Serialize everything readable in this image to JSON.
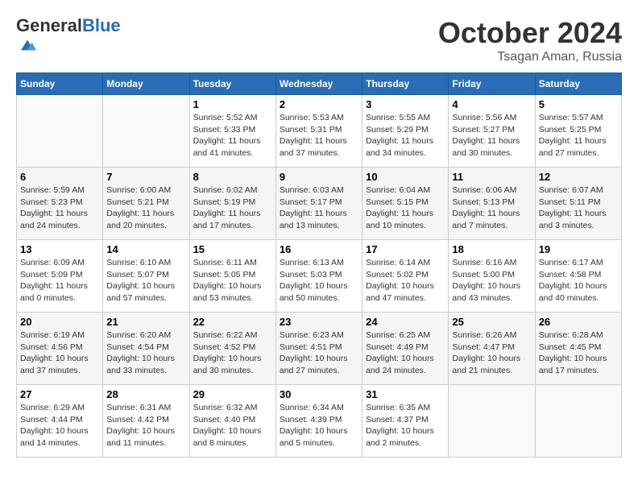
{
  "logo": {
    "general": "General",
    "blue": "Blue"
  },
  "header": {
    "month": "October 2024",
    "location": "Tsagan Aman, Russia"
  },
  "days_of_week": [
    "Sunday",
    "Monday",
    "Tuesday",
    "Wednesday",
    "Thursday",
    "Friday",
    "Saturday"
  ],
  "weeks": [
    [
      {
        "day": "",
        "detail": ""
      },
      {
        "day": "",
        "detail": ""
      },
      {
        "day": "1",
        "detail": "Sunrise: 5:52 AM\nSunset: 5:33 PM\nDaylight: 11 hours and 41 minutes."
      },
      {
        "day": "2",
        "detail": "Sunrise: 5:53 AM\nSunset: 5:31 PM\nDaylight: 11 hours and 37 minutes."
      },
      {
        "day": "3",
        "detail": "Sunrise: 5:55 AM\nSunset: 5:29 PM\nDaylight: 11 hours and 34 minutes."
      },
      {
        "day": "4",
        "detail": "Sunrise: 5:56 AM\nSunset: 5:27 PM\nDaylight: 11 hours and 30 minutes."
      },
      {
        "day": "5",
        "detail": "Sunrise: 5:57 AM\nSunset: 5:25 PM\nDaylight: 11 hours and 27 minutes."
      }
    ],
    [
      {
        "day": "6",
        "detail": "Sunrise: 5:59 AM\nSunset: 5:23 PM\nDaylight: 11 hours and 24 minutes."
      },
      {
        "day": "7",
        "detail": "Sunrise: 6:00 AM\nSunset: 5:21 PM\nDaylight: 11 hours and 20 minutes."
      },
      {
        "day": "8",
        "detail": "Sunrise: 6:02 AM\nSunset: 5:19 PM\nDaylight: 11 hours and 17 minutes."
      },
      {
        "day": "9",
        "detail": "Sunrise: 6:03 AM\nSunset: 5:17 PM\nDaylight: 11 hours and 13 minutes."
      },
      {
        "day": "10",
        "detail": "Sunrise: 6:04 AM\nSunset: 5:15 PM\nDaylight: 11 hours and 10 minutes."
      },
      {
        "day": "11",
        "detail": "Sunrise: 6:06 AM\nSunset: 5:13 PM\nDaylight: 11 hours and 7 minutes."
      },
      {
        "day": "12",
        "detail": "Sunrise: 6:07 AM\nSunset: 5:11 PM\nDaylight: 11 hours and 3 minutes."
      }
    ],
    [
      {
        "day": "13",
        "detail": "Sunrise: 6:09 AM\nSunset: 5:09 PM\nDaylight: 11 hours and 0 minutes."
      },
      {
        "day": "14",
        "detail": "Sunrise: 6:10 AM\nSunset: 5:07 PM\nDaylight: 10 hours and 57 minutes."
      },
      {
        "day": "15",
        "detail": "Sunrise: 6:11 AM\nSunset: 5:05 PM\nDaylight: 10 hours and 53 minutes."
      },
      {
        "day": "16",
        "detail": "Sunrise: 6:13 AM\nSunset: 5:03 PM\nDaylight: 10 hours and 50 minutes."
      },
      {
        "day": "17",
        "detail": "Sunrise: 6:14 AM\nSunset: 5:02 PM\nDaylight: 10 hours and 47 minutes."
      },
      {
        "day": "18",
        "detail": "Sunrise: 6:16 AM\nSunset: 5:00 PM\nDaylight: 10 hours and 43 minutes."
      },
      {
        "day": "19",
        "detail": "Sunrise: 6:17 AM\nSunset: 4:58 PM\nDaylight: 10 hours and 40 minutes."
      }
    ],
    [
      {
        "day": "20",
        "detail": "Sunrise: 6:19 AM\nSunset: 4:56 PM\nDaylight: 10 hours and 37 minutes."
      },
      {
        "day": "21",
        "detail": "Sunrise: 6:20 AM\nSunset: 4:54 PM\nDaylight: 10 hours and 33 minutes."
      },
      {
        "day": "22",
        "detail": "Sunrise: 6:22 AM\nSunset: 4:52 PM\nDaylight: 10 hours and 30 minutes."
      },
      {
        "day": "23",
        "detail": "Sunrise: 6:23 AM\nSunset: 4:51 PM\nDaylight: 10 hours and 27 minutes."
      },
      {
        "day": "24",
        "detail": "Sunrise: 6:25 AM\nSunset: 4:49 PM\nDaylight: 10 hours and 24 minutes."
      },
      {
        "day": "25",
        "detail": "Sunrise: 6:26 AM\nSunset: 4:47 PM\nDaylight: 10 hours and 21 minutes."
      },
      {
        "day": "26",
        "detail": "Sunrise: 6:28 AM\nSunset: 4:45 PM\nDaylight: 10 hours and 17 minutes."
      }
    ],
    [
      {
        "day": "27",
        "detail": "Sunrise: 6:29 AM\nSunset: 4:44 PM\nDaylight: 10 hours and 14 minutes."
      },
      {
        "day": "28",
        "detail": "Sunrise: 6:31 AM\nSunset: 4:42 PM\nDaylight: 10 hours and 11 minutes."
      },
      {
        "day": "29",
        "detail": "Sunrise: 6:32 AM\nSunset: 4:40 PM\nDaylight: 10 hours and 8 minutes."
      },
      {
        "day": "30",
        "detail": "Sunrise: 6:34 AM\nSunset: 4:39 PM\nDaylight: 10 hours and 5 minutes."
      },
      {
        "day": "31",
        "detail": "Sunrise: 6:35 AM\nSunset: 4:37 PM\nDaylight: 10 hours and 2 minutes."
      },
      {
        "day": "",
        "detail": ""
      },
      {
        "day": "",
        "detail": ""
      }
    ]
  ]
}
